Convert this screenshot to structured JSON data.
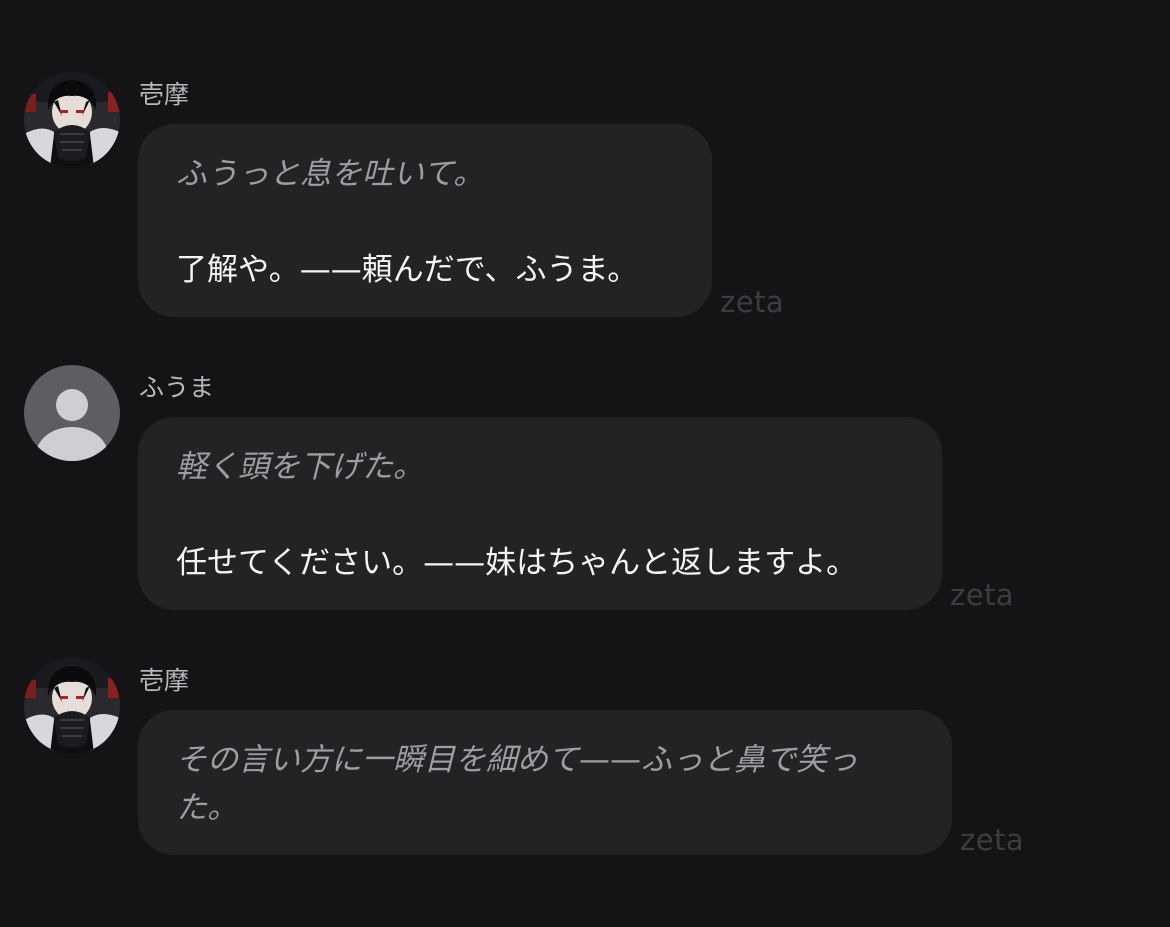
{
  "messages": [
    {
      "sender": "壱摩",
      "avatar": "character-portrait-avatar",
      "narration": "ふうっと息を吐いて。",
      "speech": "了解や。——頼んだで、ふうま。",
      "watermark": "zeta"
    },
    {
      "sender": "ふうま",
      "avatar": "default-user-avatar",
      "narration": "軽く頭を下げた。",
      "speech": "任せてください。——妹はちゃんと返しますよ。",
      "watermark": "zeta"
    },
    {
      "sender": "壱摩",
      "avatar": "character-portrait-avatar",
      "narration": "その言い方に一瞬目を細めて——ふっと鼻で笑った。",
      "watermark": "zeta"
    }
  ],
  "colors": {
    "background": "#141416",
    "bubble": "#232325",
    "sender_name": "#b9b9bd",
    "narration_text": "#9d9da2",
    "speech_text": "#f4f4f6",
    "watermark": "#3d3d41"
  }
}
